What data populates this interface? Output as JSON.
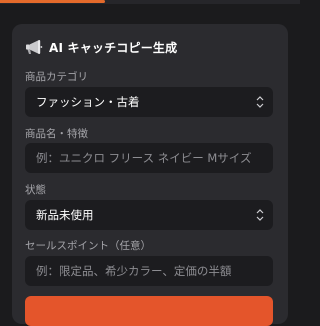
{
  "card": {
    "title": "AI キャッチコピー生成",
    "header_icon": "megaphone-icon"
  },
  "fields": {
    "category": {
      "label": "商品カテゴリ",
      "selected": "ファッション・古着"
    },
    "product_name": {
      "label": "商品名・特徴",
      "placeholder": "例：ユニクロ フリース ネイビー Mサイズ"
    },
    "condition": {
      "label": "状態",
      "selected": "新品未使用"
    },
    "selling_points": {
      "label": "セールスポイント（任意）",
      "placeholder": "例：限定品、希少カラー、定価の半額"
    }
  },
  "progress": {
    "fraction": 0.35
  },
  "colors": {
    "accent": "#e4552b",
    "progress": "#e46a2b",
    "card_bg": "#2b2b2f",
    "input_bg": "#1c1c1f",
    "page_bg": "#1b1b1d"
  }
}
